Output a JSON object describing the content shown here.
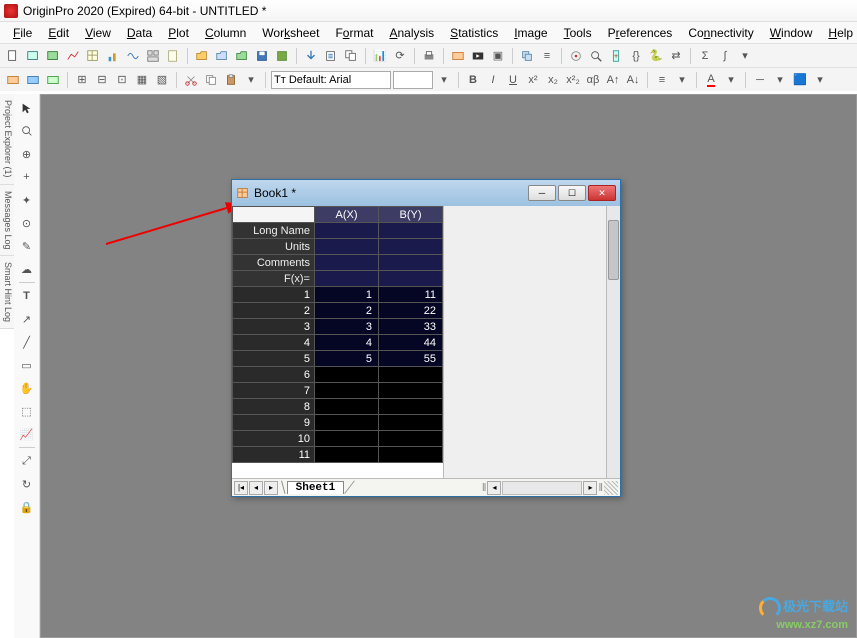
{
  "app": {
    "title": "OriginPro 2020 (Expired) 64-bit - UNTITLED *"
  },
  "menu": [
    "File",
    "Edit",
    "View",
    "Data",
    "Plot",
    "Column",
    "Worksheet",
    "Format",
    "Analysis",
    "Statistics",
    "Image",
    "Tools",
    "Preferences",
    "Connectivity",
    "Window",
    "Help"
  ],
  "toolbar2": {
    "font_label": "Tᴛ Default: Arial",
    "font_size": ""
  },
  "side_panels": [
    "Project Explorer (1)",
    "Messages Log",
    "Smart Hint Log"
  ],
  "book": {
    "title": "Book1 *",
    "columns": [
      "A(X)",
      "B(Y)"
    ],
    "meta_rows": [
      "Long Name",
      "Units",
      "Comments",
      "F(x)="
    ],
    "rows": [
      {
        "n": "1",
        "a": "1",
        "b": "11"
      },
      {
        "n": "2",
        "a": "2",
        "b": "22"
      },
      {
        "n": "3",
        "a": "3",
        "b": "33"
      },
      {
        "n": "4",
        "a": "4",
        "b": "44"
      },
      {
        "n": "5",
        "a": "5",
        "b": "55"
      },
      {
        "n": "6",
        "a": "",
        "b": ""
      },
      {
        "n": "7",
        "a": "",
        "b": ""
      },
      {
        "n": "8",
        "a": "",
        "b": ""
      },
      {
        "n": "9",
        "a": "",
        "b": ""
      },
      {
        "n": "10",
        "a": "",
        "b": ""
      },
      {
        "n": "11",
        "a": "",
        "b": ""
      }
    ],
    "sheet_tab": "Sheet1"
  },
  "watermark": {
    "line1": "极光下载站",
    "line2": "www.xz7.com"
  }
}
